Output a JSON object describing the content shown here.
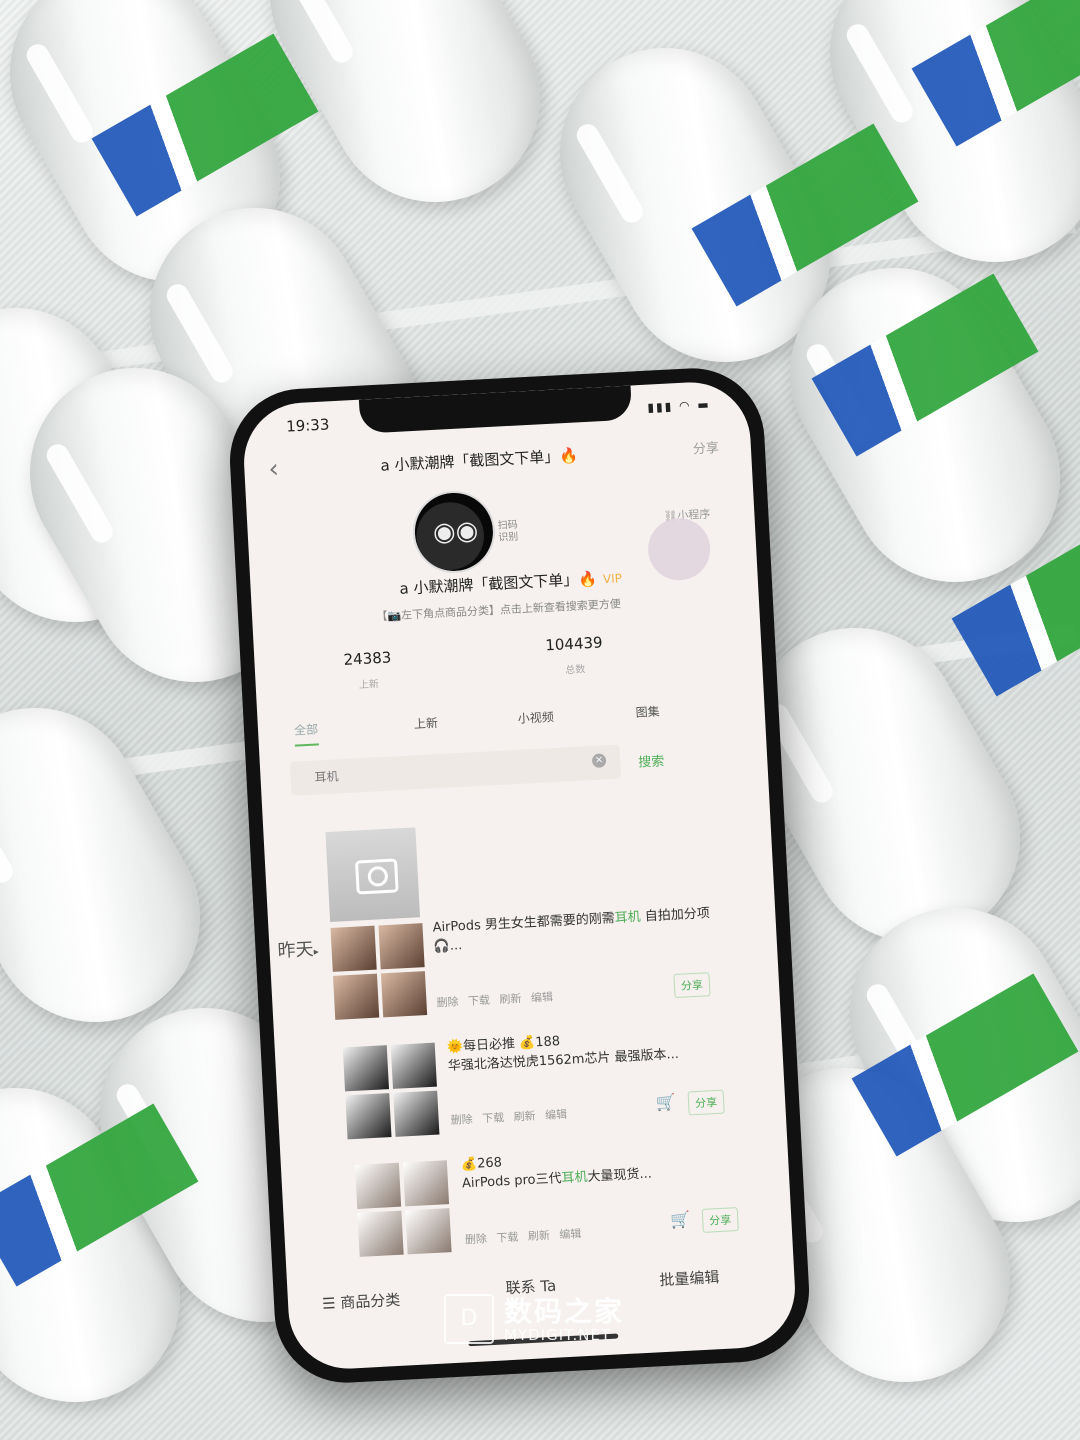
{
  "status_bar": {
    "time": "19:33",
    "icons": "▮▮▮ ◠ ▬"
  },
  "nav": {
    "back": "‹",
    "title": "a 小默潮牌「截图文下单」🔥",
    "share": "分享"
  },
  "profile": {
    "avatar_face": "◉◉",
    "qr_label": "扫码\n识别",
    "mini_program": "小程序",
    "name": "a 小默潮牌「截图文下单」🔥",
    "vip": "VIP",
    "desc": "【📷左下角点商品分类】点击上新查看搜索更方便",
    "stats": [
      {
        "num": "24383",
        "label": "上新"
      },
      {
        "num": "104439",
        "label": "总数"
      }
    ]
  },
  "tabs": [
    "全部",
    "上新",
    "小视频",
    "图集"
  ],
  "search": {
    "value": "耳机",
    "clear": "×",
    "button": "搜索"
  },
  "day_label": "昨天",
  "posts": [
    {
      "title_pre": "AirPods 男生女生都需要的刚需",
      "title_hl": "耳机",
      "title_post": " 自拍加分项🎧...",
      "actions": "删除 下载 刷新 编辑",
      "share": "分享"
    },
    {
      "title_pre": "🌞每日必推 💰188\n华强北洛达悦虎1562m芯片 最强版本...",
      "title_hl": "",
      "title_post": "",
      "actions": "删除 下载 刷新 编辑",
      "share": "分享",
      "cart": "🛒"
    },
    {
      "title_pre": "💰268\nAirPods pro三代",
      "title_hl": "耳机",
      "title_post": "大量现货...",
      "actions": "删除 下载 刷新 编辑",
      "share": "分享",
      "cart": "🛒"
    }
  ],
  "bottom_bar": {
    "categories": "☰ 商品分类",
    "contact": "联系 Ta",
    "batch_edit": "批量编辑"
  },
  "watermark": {
    "icon": "D",
    "text": "数码之家",
    "sub": "MYDIGIT.NET"
  },
  "colors": {
    "accent_green": "#4fae58",
    "tape_blue": "#1e56b8",
    "tape_green": "#2ea43a",
    "vip_gold": "#f1b34a"
  }
}
